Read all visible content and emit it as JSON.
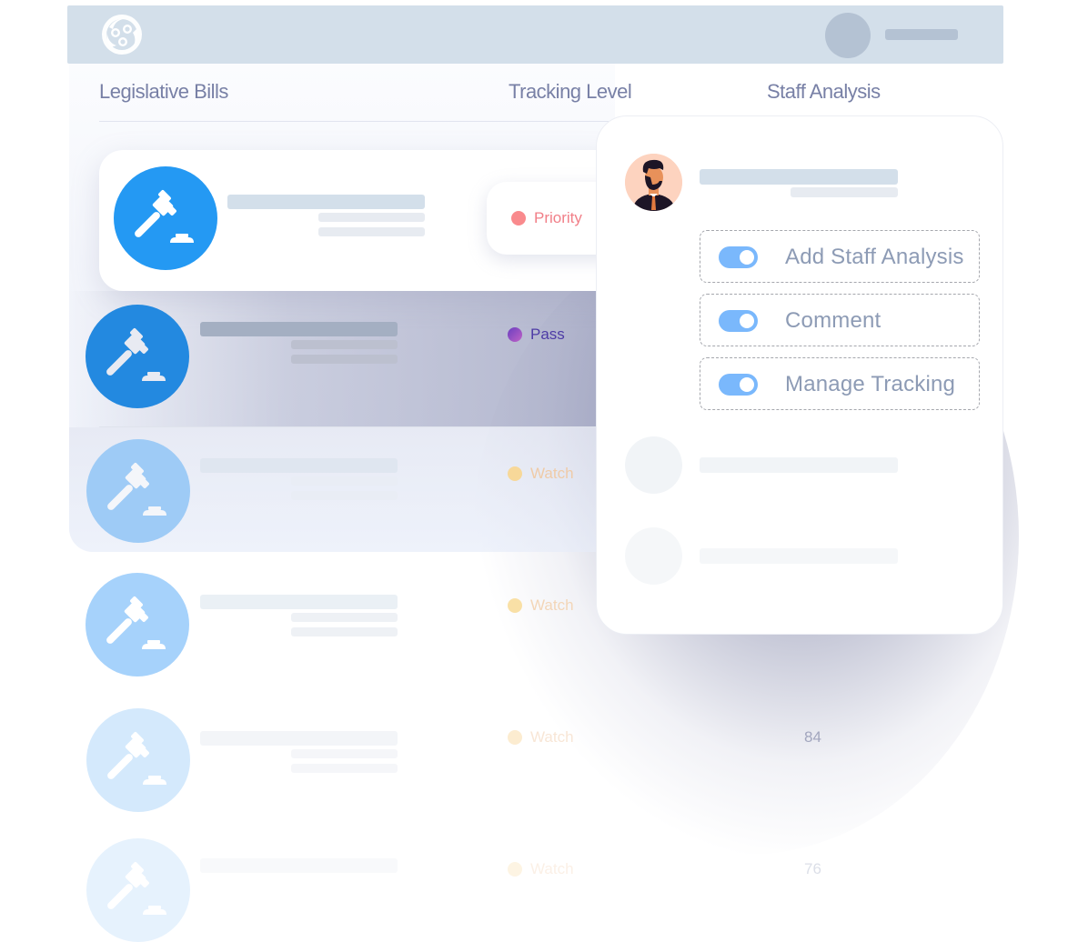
{
  "header": {
    "logo_icon": "community-circle-logo",
    "user_avatar": "user-avatar-placeholder"
  },
  "columns": {
    "bills": "Legislative Bills",
    "tracking": "Tracking Level",
    "analysis": "Staff Analysis"
  },
  "bills": [
    {
      "icon": "gavel-icon",
      "tracking": "Priority",
      "status_color": "#f98a8d",
      "text_color": "#f17f88",
      "score": ""
    },
    {
      "icon": "gavel-icon",
      "tracking": "Pass",
      "status_color": "#8b4fc9",
      "text_color": "#4d3ba6",
      "score": ""
    },
    {
      "icon": "gavel-icon",
      "tracking": "Watch",
      "status_color": "#f7d899",
      "text_color": "#efcba8",
      "score": ""
    },
    {
      "icon": "gavel-icon",
      "tracking": "Watch",
      "status_color": "#f9e0a6",
      "text_color": "#f3d6b8",
      "score": ""
    },
    {
      "icon": "gavel-icon",
      "tracking": "Watch",
      "status_color": "#fcecd0",
      "text_color": "#f8e6d6",
      "score": "84"
    },
    {
      "icon": "gavel-icon",
      "tracking": "Watch",
      "status_color": "#fdf4e3",
      "text_color": "#fbf0e6",
      "score": "76"
    }
  ],
  "popup": {
    "avatar_icon": "bearded-man-avatar",
    "permissions": [
      {
        "label": "Add Staff Analysis",
        "enabled": true
      },
      {
        "label": "Comment",
        "enabled": true
      },
      {
        "label": "Manage Tracking",
        "enabled": true
      }
    ]
  },
  "colors": {
    "header_bg": "#d3dfea",
    "gavel_primary": "#2196f3",
    "toggle_on": "#7ab8fc",
    "heading_text": "#7880a6"
  }
}
